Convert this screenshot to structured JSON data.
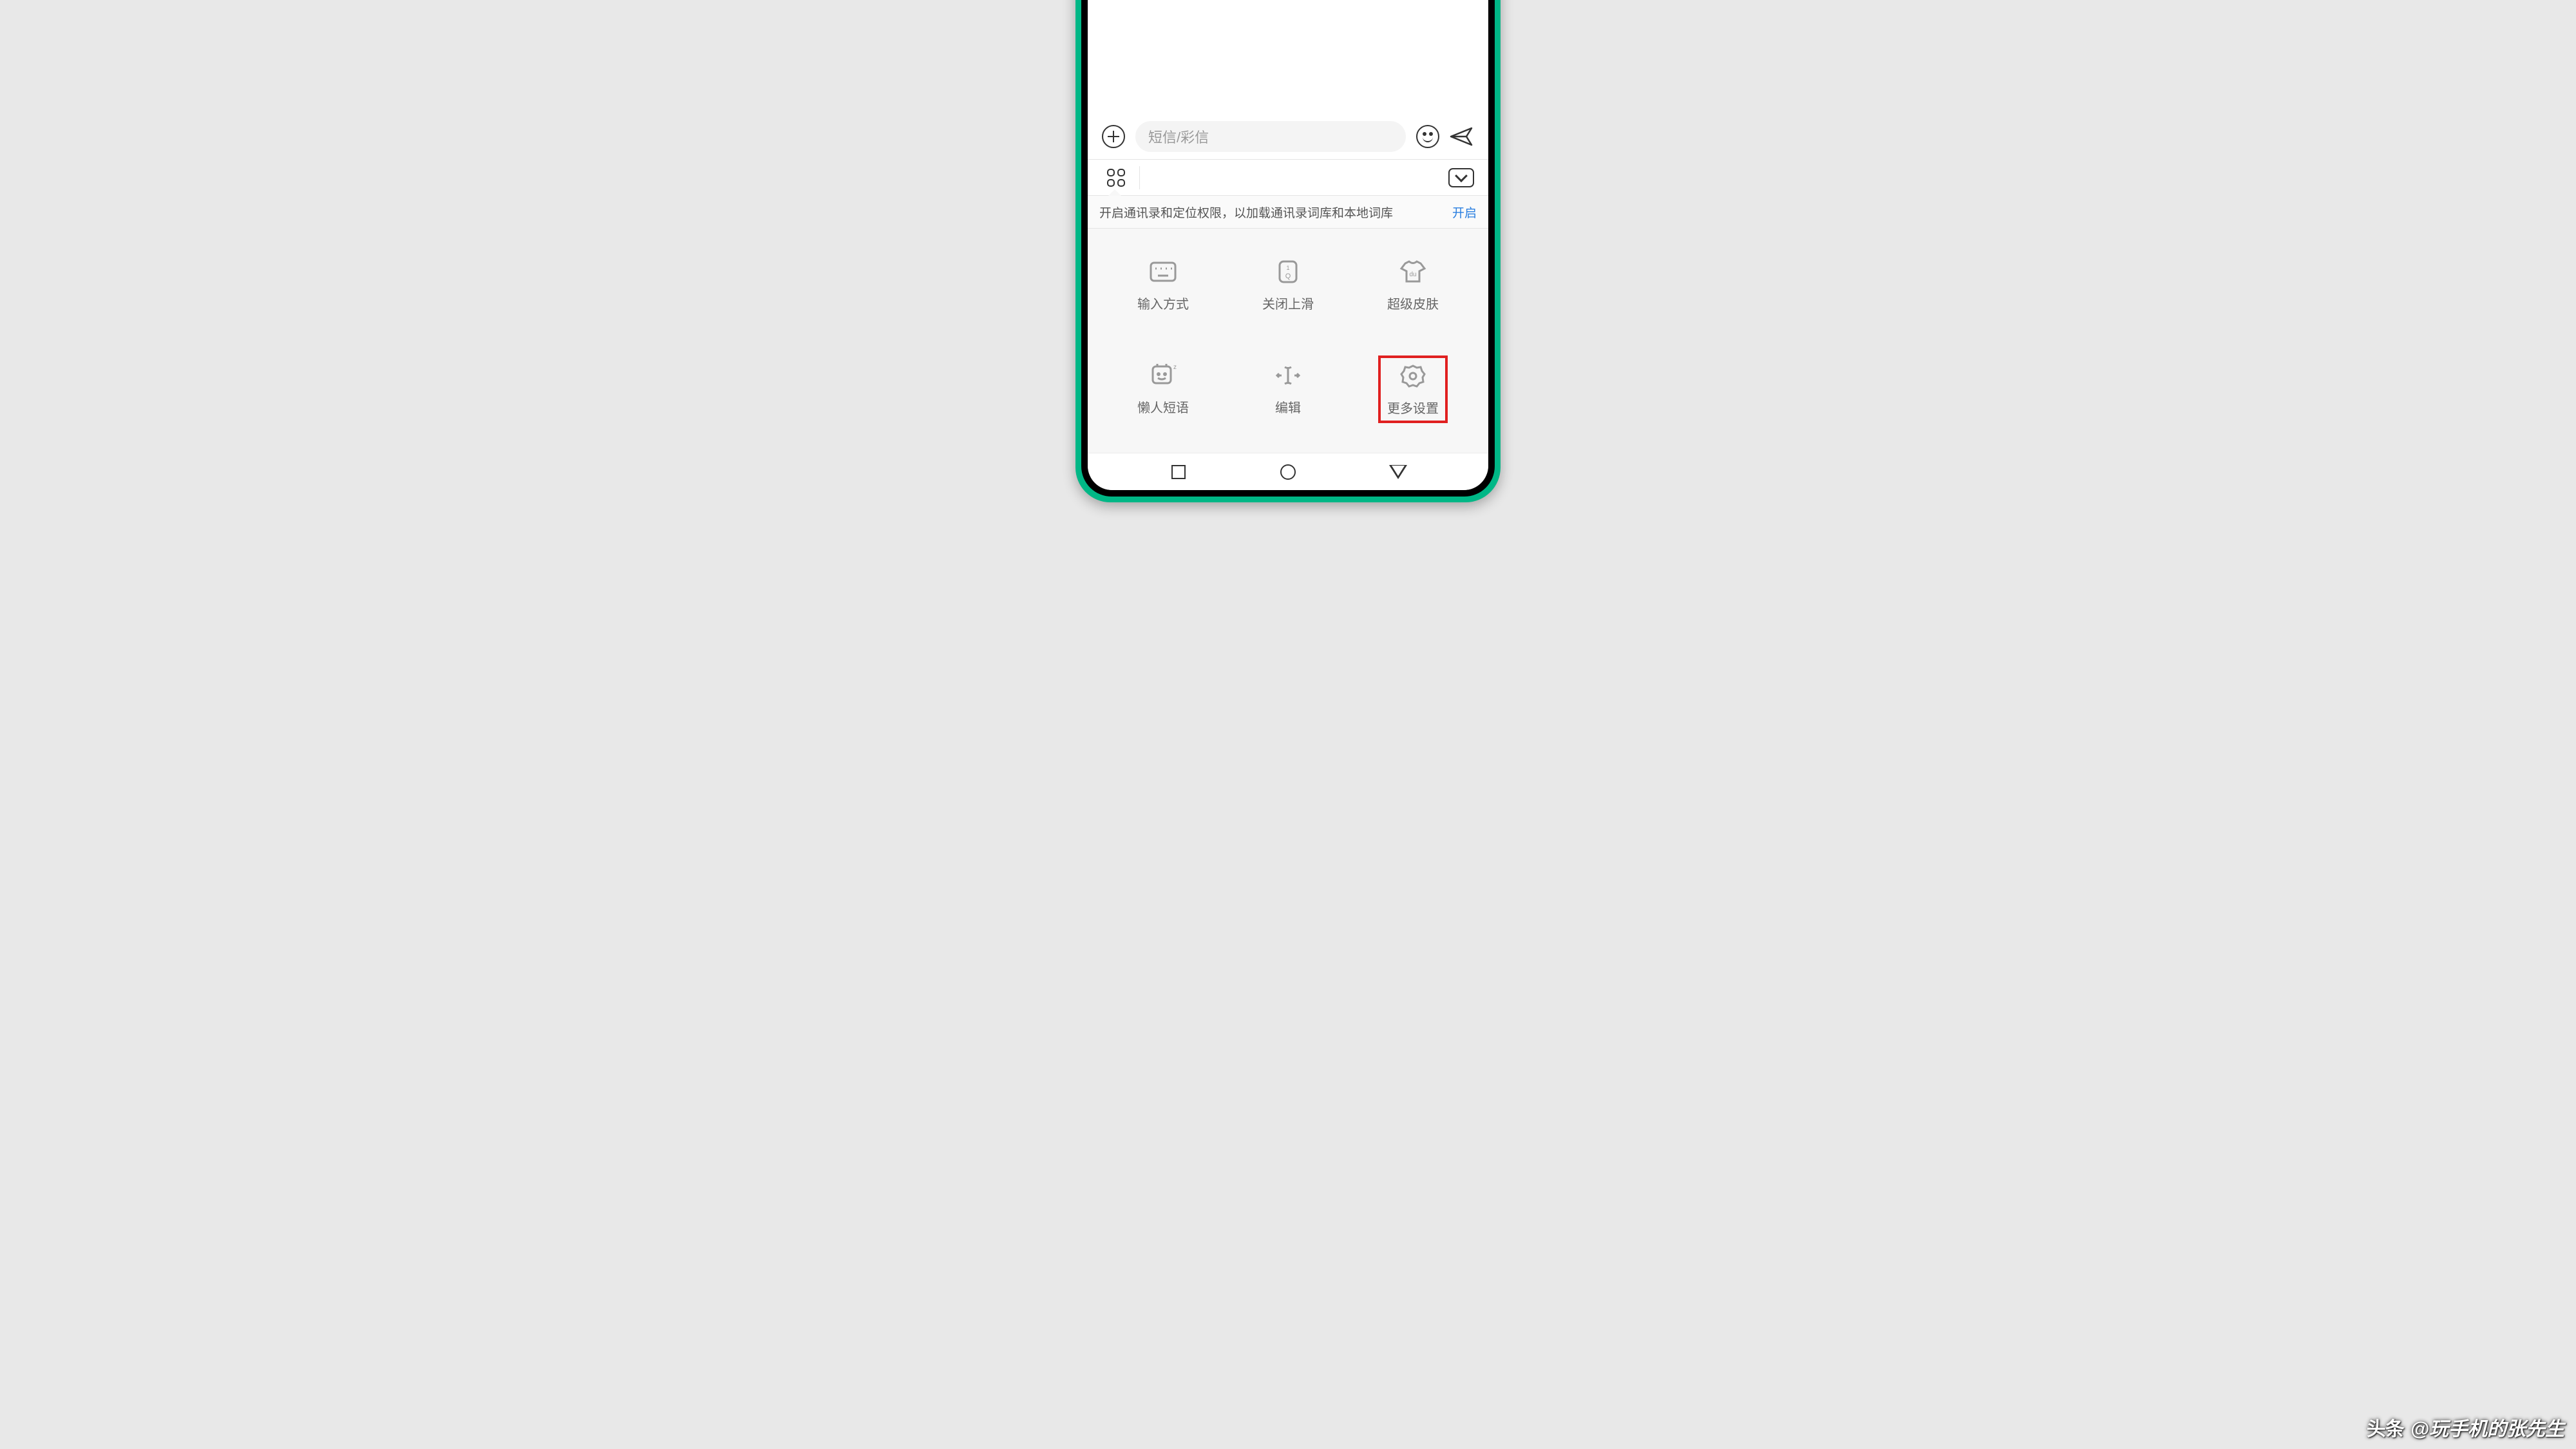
{
  "input": {
    "placeholder": "短信/彩信"
  },
  "permission": {
    "text": "开启通讯录和定位权限，以加载通讯录词库和本地词库",
    "action": "开启"
  },
  "grid": {
    "items": [
      {
        "label": "输入方式"
      },
      {
        "label": "关闭上滑"
      },
      {
        "label": "超级皮肤"
      },
      {
        "label": "懒人短语"
      },
      {
        "label": "编辑"
      },
      {
        "label": "更多设置"
      }
    ]
  },
  "watermark": {
    "logo": "头条",
    "author": "@玩手机的张先生"
  }
}
